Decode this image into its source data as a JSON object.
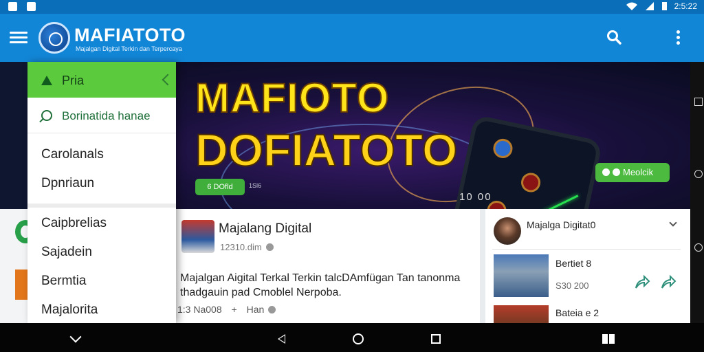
{
  "status_bar": {
    "time": "2:5:22"
  },
  "app_bar": {
    "brand": "MAFIATOTO",
    "tagline": "Majalgan Digital Terkin dan Terpercaya",
    "icons": [
      "menu-icon",
      "search-icon",
      "more-vert-icon"
    ]
  },
  "hero": {
    "title_line1": "MAFIOTO",
    "title_line2": "DOFIATOTO",
    "badge": "6 DOfld",
    "badge_caption": "1Sl6",
    "numbers": "10  00",
    "button": "Meolcik",
    "colors": {
      "accent_green": "#4cba3e",
      "title_yellow": "#ffe41a"
    }
  },
  "drawer": {
    "active_item": "Pria",
    "search_item": "Borinatida hanae",
    "items_top": [
      "Carolanals",
      "Dpnriaun"
    ],
    "items_bottom": [
      "Caipbrelias",
      "Sajadein",
      "Bermtia",
      "Majalorita"
    ]
  },
  "post": {
    "author": "Majalang Digital",
    "time": "12310.dim",
    "body": "Majalgan Aigital Terkal Terkin talcDAmfügan Tan tanonma thadgauin pad Cmoblel Nerpoba.",
    "footer_time": "1:3 Na008",
    "footer_label": "Han"
  },
  "sidebar": {
    "header": "Majalga Digitat0",
    "items": [
      {
        "title": "Bertiet 8",
        "sub": "S30 200"
      },
      {
        "title": "Bateia e 2",
        "sub": ""
      }
    ]
  }
}
